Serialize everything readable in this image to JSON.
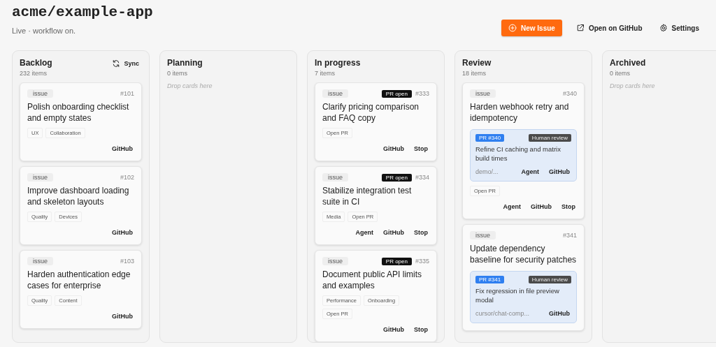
{
  "header": {
    "title": "acme/example-app",
    "subtitle": "Live · workflow on.",
    "actions": [
      {
        "kind": "primary",
        "label": "New Issue"
      },
      {
        "kind": "external",
        "label": "Open on GitHub"
      },
      {
        "kind": "settings",
        "label": "Settings"
      }
    ]
  },
  "columns": [
    {
      "name": "Backlog",
      "count": "232 items",
      "sync": "Sync",
      "cards": [
        {
          "type": "issue",
          "number": "#101",
          "title": "Polish onboarding checklist and empty states",
          "tags": [
            "UX",
            "Collaboration"
          ],
          "actions": [
            "GitHub"
          ]
        },
        {
          "type": "issue",
          "number": "#102",
          "title": "Improve dashboard loading and skeleton layouts",
          "tags": [
            "Quality",
            "Devices"
          ],
          "actions": [
            "GitHub"
          ]
        },
        {
          "type": "issue",
          "number": "#103",
          "title": "Harden authentication edge cases for enterprise",
          "tags": [
            "Quality",
            "Content"
          ],
          "actions": [
            "GitHub"
          ]
        }
      ]
    },
    {
      "name": "Planning",
      "count": "0 items",
      "empty": "Drop cards here"
    },
    {
      "name": "In progress",
      "count": "7 items",
      "cards": [
        {
          "type": "issue",
          "badge": "PR open",
          "number": "#333",
          "title": "Clarify pricing comparison and FAQ copy",
          "tags": [
            "Open PR"
          ],
          "actions": [
            "GitHub",
            "Stop"
          ]
        },
        {
          "type": "issue",
          "badge": "PR open",
          "number": "#334",
          "title": "Stabilize integration test suite in CI",
          "tags": [
            "Media",
            "Open PR"
          ],
          "actions": [
            "Agent",
            "GitHub",
            "Stop"
          ]
        },
        {
          "type": "issue",
          "badge": "PR open",
          "number": "#335",
          "title": "Document public API limits and examples",
          "tags": [
            "Performance",
            "Onboarding",
            "Open PR"
          ],
          "actions": [
            "GitHub",
            "Stop"
          ]
        }
      ]
    },
    {
      "name": "Review",
      "count": "18 items",
      "cards": [
        {
          "type": "issue",
          "number": "#340",
          "title": "Harden webhook retry and idempotency",
          "pr": {
            "label": "PR #340",
            "status": "Human review",
            "title": "Refine CI caching and matrix build times",
            "branch": "demo/...",
            "actions": [
              "Agent",
              "GitHub"
            ]
          },
          "tags": [
            "Open PR"
          ],
          "actions": [
            "Agent",
            "GitHub",
            "Stop"
          ]
        },
        {
          "type": "issue",
          "number": "#341",
          "title": "Update dependency baseline for security patches",
          "pr": {
            "label": "PR #341",
            "status": "Human review",
            "title": "Fix regression in file preview modal",
            "branch": "cursor/chat-comp...",
            "actions": [
              "GitHub"
            ]
          }
        }
      ]
    },
    {
      "name": "Archived",
      "count": "0 items",
      "empty": "Drop cards here"
    }
  ]
}
